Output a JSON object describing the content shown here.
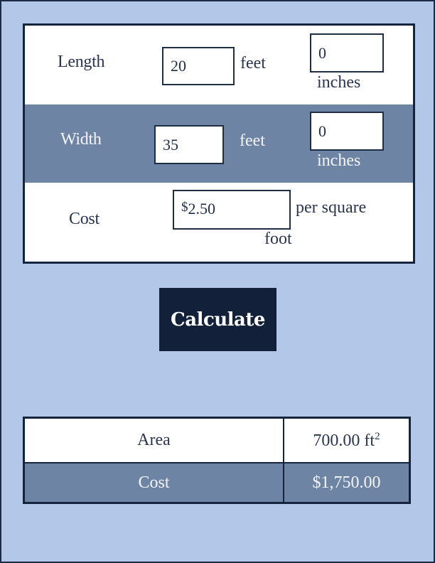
{
  "form": {
    "length": {
      "label": "Length",
      "feet_value": "20",
      "feet_unit": "feet",
      "inches_value": "0",
      "inches_unit": "inches"
    },
    "width": {
      "label": "Width",
      "feet_value": "35",
      "feet_unit": "feet",
      "inches_value": "0",
      "inches_unit": "inches"
    },
    "cost": {
      "label": "Cost",
      "currency_symbol": "$",
      "value": "2.50",
      "unit_line1": "per square",
      "unit_line2": "foot"
    }
  },
  "calculate_button": {
    "label": "Calculate"
  },
  "results": {
    "area": {
      "label": "Area",
      "value": "700.00 ft",
      "unit_superscript": "2"
    },
    "cost": {
      "label": "Cost",
      "value": "$1,750.00"
    }
  },
  "colors": {
    "background": "#b3c8e8",
    "dark": "#12203a",
    "alt_row": "#6e84a4"
  }
}
